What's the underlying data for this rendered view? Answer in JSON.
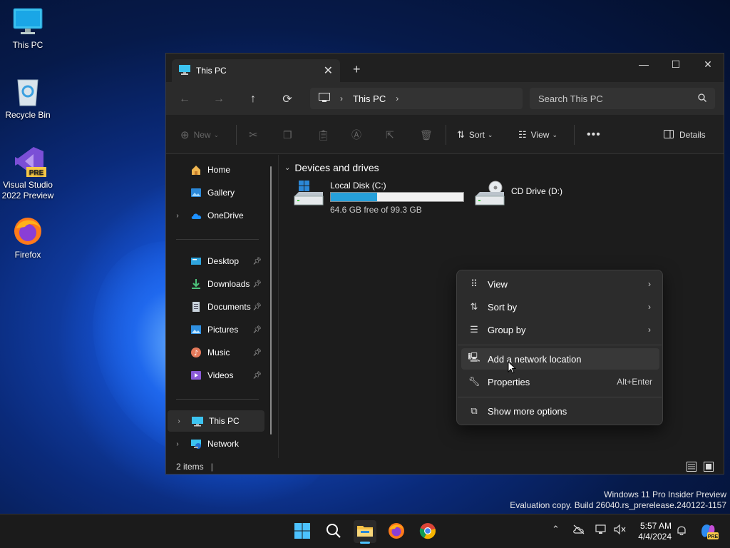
{
  "desktop": {
    "icons": [
      {
        "label": "This PC"
      },
      {
        "label": "Recycle Bin"
      },
      {
        "label": "Visual Studio 2022 Preview"
      },
      {
        "label": "Firefox"
      }
    ],
    "vs_badge": "PRE"
  },
  "window": {
    "tab_title": "This PC",
    "nav": {
      "address_segment": "This PC",
      "search_placeholder": "Search This PC"
    },
    "commands": {
      "new": "New",
      "sort": "Sort",
      "view": "View",
      "details": "Details"
    },
    "sidebar": {
      "items": [
        {
          "label": "Home"
        },
        {
          "label": "Gallery"
        },
        {
          "label": "OneDrive"
        },
        {
          "label": "Desktop"
        },
        {
          "label": "Downloads"
        },
        {
          "label": "Documents"
        },
        {
          "label": "Pictures"
        },
        {
          "label": "Music"
        },
        {
          "label": "Videos"
        },
        {
          "label": "This PC"
        },
        {
          "label": "Network"
        }
      ]
    },
    "content": {
      "group_header": "Devices and drives",
      "drives": [
        {
          "name": "Local Disk (C:)",
          "space": "64.6 GB free of 99.3 GB",
          "used_fraction": 0.35
        },
        {
          "name": "CD Drive (D:)"
        }
      ]
    },
    "status": {
      "items_count": "2 items"
    }
  },
  "context_menu": {
    "items": [
      {
        "label": "View"
      },
      {
        "label": "Sort by"
      },
      {
        "label": "Group by"
      },
      {
        "label": "Add a network location"
      },
      {
        "label": "Properties",
        "shortcut": "Alt+Enter"
      },
      {
        "label": "Show more options"
      }
    ]
  },
  "watermark": {
    "line1": "Windows 11 Pro Insider Preview",
    "line2": "Evaluation copy. Build 26040.rs_prerelease.240122-1157"
  },
  "taskbar": {
    "time": "5:57 AM",
    "date": "4/4/2024",
    "copilot_badge": "PRE"
  },
  "colors": {
    "accent": "#26a0da",
    "window_bg": "#1c1c1c",
    "menu_bg": "#2c2c2c"
  }
}
